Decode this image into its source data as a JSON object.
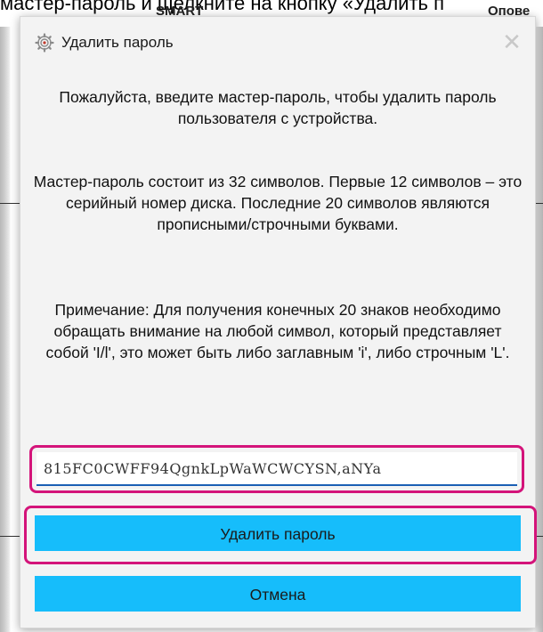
{
  "background": {
    "instruction_text": "мастер-пароль и щелкните на кнопку «Удалить п",
    "column_smart": "SMART",
    "column_notify": "Опове"
  },
  "dialog": {
    "title": "Удалить пароль",
    "close_glyph": "✕",
    "paragraph1": "Пожалуйста, введите мастер-пароль, чтобы удалить пароль пользователя с устройства.",
    "paragraph2": "Мастер-пароль состоит из 32 символов. Первые 12 символов – это серийный номер диска. Последние 20 символов являются прописными/строчными буквами.",
    "paragraph3": "Примечание: Для получения конечных 20 знаков необходимо обращать внимание на любой символ, который представляет собой 'I/l', это может быть либо заглавным 'i', либо строчным 'L'.",
    "password_value": "815FC0CWFF94QgnkLpWaWCWCYSN,aNYa",
    "delete_button_label": "Удалить пароль",
    "cancel_button_label": "Отмена"
  },
  "colors": {
    "button_bg": "#16bdfb",
    "highlight": "#d4147a",
    "input_underline": "#1a5fb4"
  },
  "icons": {
    "title_icon": "gear-icon",
    "close_icon": "close-icon"
  }
}
